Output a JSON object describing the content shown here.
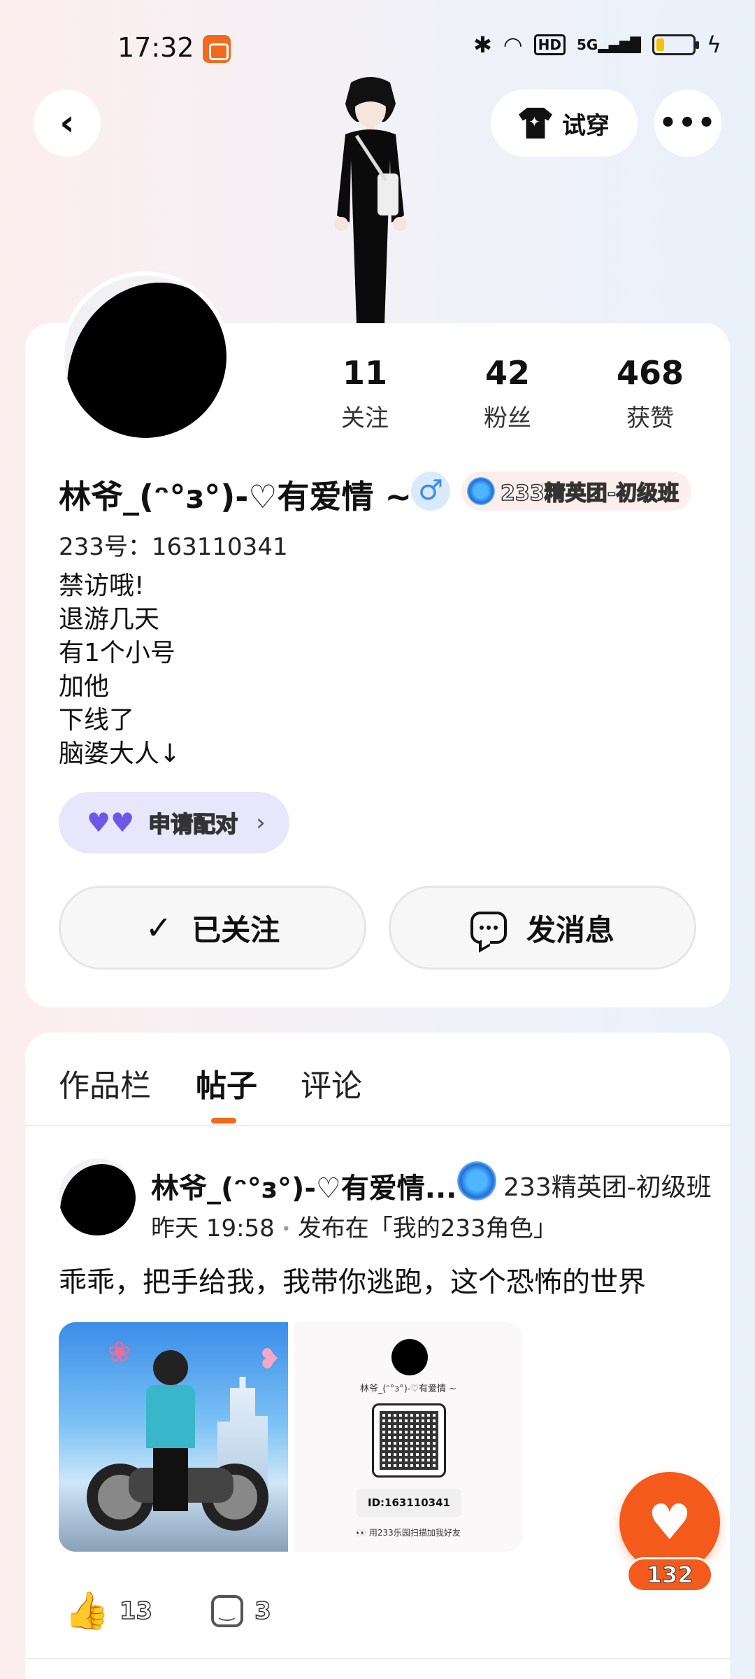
{
  "status_bar": {
    "time": "17:32",
    "icons": [
      "bluetooth-icon",
      "wifi-icon",
      "hd-icon",
      "5g-signal-icon",
      "battery-icon",
      "charging-icon"
    ],
    "hd": "HD",
    "network": "5G",
    "battery_level": 0.2
  },
  "nav": {
    "back_icon": "‹",
    "tryon_label": "试穿",
    "more_icon": "•••"
  },
  "profile": {
    "stats": [
      {
        "value": "11",
        "label": "关注"
      },
      {
        "value": "42",
        "label": "粉丝"
      },
      {
        "value": "468",
        "label": "获赞"
      }
    ],
    "name": "林爷_(ᵔ°з°)-♡有爱情 ~",
    "gender_icon": "♂",
    "team_badge": "233精英团-初级班",
    "uid": "233号：163110341",
    "bio": [
      "禁访哦!",
      "退游几天",
      "有1个小号",
      "加他",
      "下线了",
      "脑婆大人↓"
    ],
    "pair_button": "申请配对",
    "pair_chevron": "›",
    "follow_check": "✓",
    "follow_button": "已关注",
    "message_button": "发消息",
    "colors": {
      "accent": "#f26a1b",
      "pair_bg": "#e8e6fb",
      "gender_bg": "#d9ebfb"
    }
  },
  "tabs": [
    {
      "label": "作品栏",
      "active": false
    },
    {
      "label": "帖子",
      "active": true
    },
    {
      "label": "评论",
      "active": false
    }
  ],
  "post": {
    "author": "林爷_(ᵔ°з°)-♡有爱情...",
    "team": "233精英团-初级班",
    "time": "昨天 19:58",
    "dot": "•",
    "posted_in": "发布在「我的233角色」",
    "text": "乖乖，把手给我，我带你逃跑，这个恐怖的世界",
    "card": {
      "name": "林爷_(ᵔ°з°)-♡有爱情 ~",
      "id": "ID:163110341",
      "hint": "👀 用233乐园扫描加我好友"
    },
    "likes": "13",
    "comments": "3"
  },
  "fab": {
    "count": "132"
  }
}
